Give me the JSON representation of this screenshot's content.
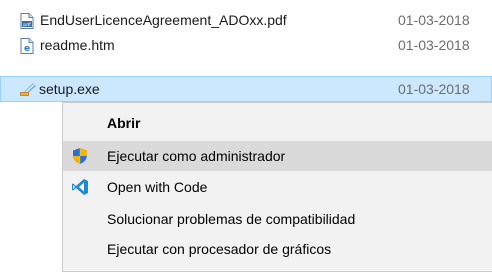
{
  "files": [
    {
      "name": "EndUserLicenceAgreement_ADOxx.pdf",
      "date": "01-03-2018",
      "icon": "pdf-file-icon"
    },
    {
      "name": "readme.htm",
      "date": "01-03-2018",
      "icon": "html-file-icon"
    },
    {
      "name": "setup.exe",
      "date": "01-03-2018",
      "icon": "installer-file-icon",
      "selected": true
    }
  ],
  "context_menu": {
    "items": [
      {
        "label": "Abrir",
        "bold": true,
        "icon": ""
      },
      {
        "label": "Ejecutar como administrador",
        "icon": "uac-shield-icon",
        "hover": true
      },
      {
        "label": "Open with Code",
        "icon": "vscode-icon"
      },
      {
        "label": "Solucionar problemas de compatibilidad",
        "icon": ""
      },
      {
        "label": "Ejecutar con procesador de gráficos",
        "icon": ""
      }
    ]
  },
  "colors": {
    "selection_bg": "#cce8ff",
    "selection_border": "#99d1ff",
    "menu_bg": "#f2f2f2",
    "menu_hover": "#dadada",
    "date_text": "#6d6d6d"
  }
}
